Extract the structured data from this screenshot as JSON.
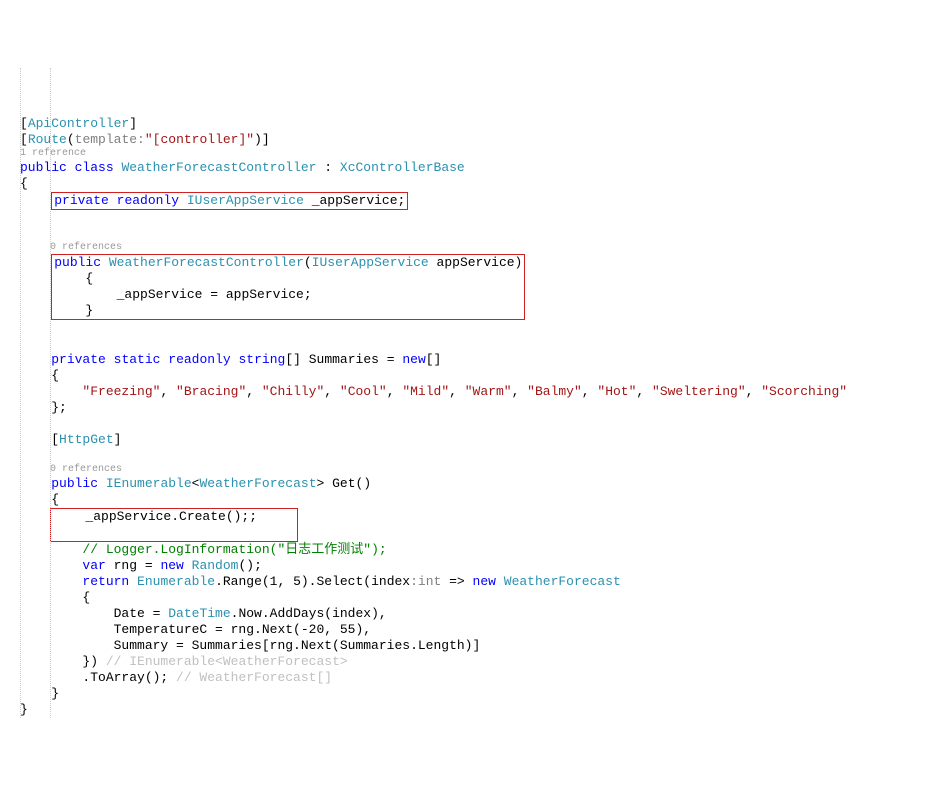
{
  "attr1_open": "[",
  "attr1_name": "ApiController",
  "attr1_close": "]",
  "attr2_open": "[",
  "attr2_name": "Route",
  "attr2_paren": "(",
  "attr2_hint": "template:",
  "attr2_val": "\"[controller]\"",
  "attr2_end": ")]",
  "ref1": "1 reference",
  "cls_kw1": "public",
  "cls_kw2": "class",
  "cls_name": "WeatherForecastController",
  "cls_colon": " : ",
  "cls_base": "XcControllerBase",
  "brace_open": "{",
  "fld_kw1": "private",
  "fld_kw2": "readonly",
  "fld_type": "IUserAppService",
  "fld_name": " _appService;",
  "ref2": "0 references",
  "ctor_kw": "public",
  "ctor_name": "WeatherForecastController",
  "ctor_po": "(",
  "ctor_ptype": "IUserAppService",
  "ctor_pname": " appService)",
  "ctor_body": "        _appService = appService;",
  "sum_kw1": "private",
  "sum_kw2": "static",
  "sum_kw3": "readonly",
  "sum_kw4": "string",
  "sum_arr": "[] Summaries = ",
  "sum_new": "new",
  "sum_arr2": "[]",
  "sum_bo": "    {",
  "sum_v1": "\"Freezing\"",
  "sum_v2": "\"Bracing\"",
  "sum_v3": "\"Chilly\"",
  "sum_v4": "\"Cool\"",
  "sum_v5": "\"Mild\"",
  "sum_v6": "\"Warm\"",
  "sum_v7": "\"Balmy\"",
  "sum_v8": "\"Hot\"",
  "sum_v9": "\"Sweltering\"",
  "sum_v10": "\"Scorching\"",
  "sum_bc": "    };",
  "httpget_open": "[",
  "httpget_name": "HttpGet",
  "httpget_close": "]",
  "ref3": "0 references",
  "get_kw": "public",
  "get_ret": "IEnumerable",
  "get_ang1": "<",
  "get_gen": "WeatherForecast",
  "get_ang2": "> Get()",
  "get_bo": "    {",
  "call_line": "        _appService.Create();;",
  "cmt1a": "        // Logger.LogInformation(",
  "cmt1b": "\"日志工作测试\"",
  "cmt1c": ");",
  "rng_kw": "var",
  "rng_rest": " rng = ",
  "rng_new": "new",
  "rng_type": "Random",
  "rng_end": "();",
  "ret_kw": "return",
  "ret_a": " ",
  "ret_enum": "Enumerable",
  "ret_b": ".Range(1, 5).Select(index",
  "ret_hint": ":int",
  "ret_c": " => ",
  "ret_new": "new",
  "ret_wf": "WeatherForecast",
  "obj_bo": "        {",
  "obj_l1a": "            Date = ",
  "obj_l1b": "DateTime",
  "obj_l1c": ".Now.AddDays(index),",
  "obj_l2": "            TemperatureC = rng.Next(-20, 55),",
  "obj_l3": "            Summary = Summaries[rng.Next(Summaries.Length)]",
  "obj_bc": "        }) ",
  "obj_cmt": "// IEnumerable<WeatherForecast>",
  "toarr": "        .ToArray(); ",
  "toarr_cmt": "// WeatherForecast[]",
  "get_bc": "    }",
  "brace_close": "}"
}
